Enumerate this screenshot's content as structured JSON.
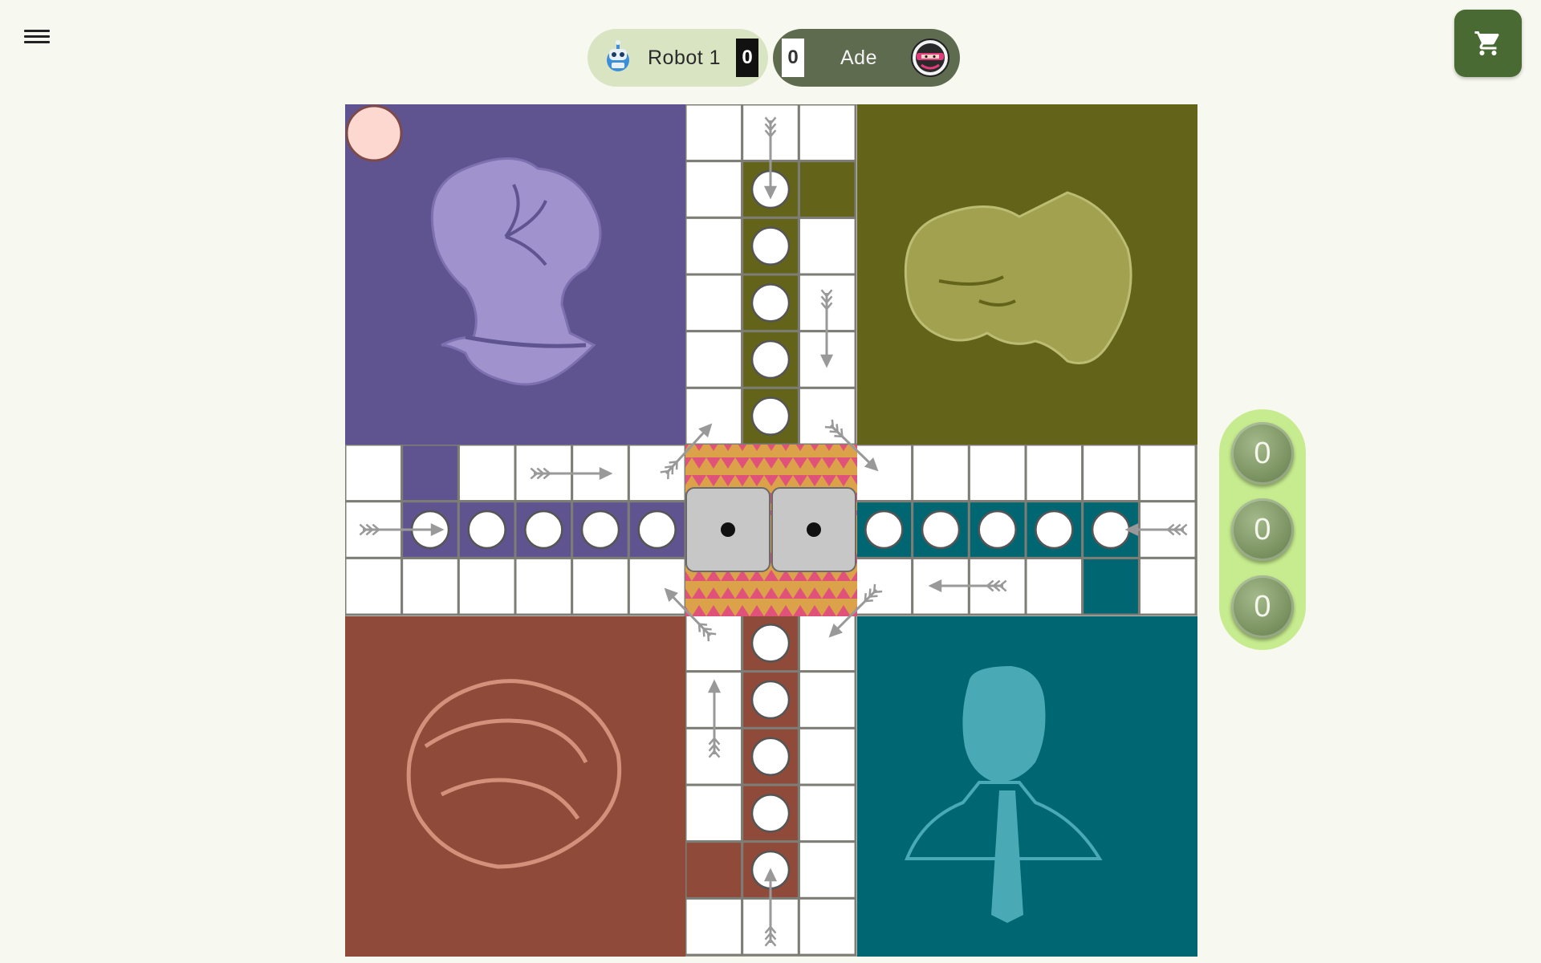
{
  "players": {
    "left": {
      "name": "Robot 1",
      "score": "0"
    },
    "right": {
      "name": "Ade",
      "score": "0"
    }
  },
  "side_scores": [
    "0",
    "0",
    "0"
  ],
  "dice": [
    1,
    1
  ],
  "colors": {
    "background": "#f7f8ef",
    "purple": "#605490",
    "olive": "#63631a",
    "red": "#8f4a3a",
    "teal": "#006672",
    "accent_green": "#4a6a33"
  },
  "icons": {
    "menu": "hamburger-menu-icon",
    "cart": "shopping-cart-icon",
    "robot_avatar": "robot-avatar-icon",
    "ade_avatar": "ninja-avatar-icon"
  }
}
